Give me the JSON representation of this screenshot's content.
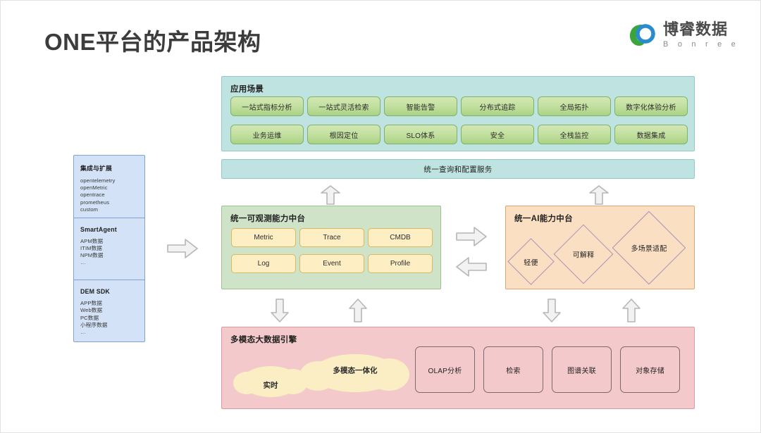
{
  "header": {
    "title": "ONE平台的产品架构",
    "logo": {
      "cn": "博睿数据",
      "en": "B o n r e e",
      "mark_green": "#3aa63a",
      "mark_blue": "#2b8ccc"
    }
  },
  "scenario": {
    "title": "应用场景",
    "panel_color": "#bfe3e0",
    "button_color": "#c3e0a0",
    "items": [
      "一站式指标分析",
      "一站式灵活检索",
      "智能告警",
      "分布式追踪",
      "全局拓扑",
      "数字化体验分析",
      "业务运维",
      "根因定位",
      "SLO体系",
      "安全",
      "全栈监控",
      "数据集成"
    ]
  },
  "query_bar": {
    "label": "统一查询和配置服务",
    "color": "#bfe3e0"
  },
  "sidebar": {
    "panel_color": "#d3e2f7",
    "sections": [
      {
        "title": "集成与扩展",
        "items": [
          "opentelemetry",
          "openMetric",
          "opentrace",
          "prometheus",
          "custom",
          "…"
        ]
      },
      {
        "title": "SmartAgent",
        "items": [
          "APM数据",
          "ITIM数据",
          "NPM数据",
          "…"
        ]
      },
      {
        "title": "DEM SDK",
        "items": [
          "APP数据",
          "Web数据",
          "PC数据",
          "小程序数据",
          "…"
        ]
      }
    ]
  },
  "observability": {
    "title": "统一可观测能力中台",
    "panel_color": "#cfe3c8",
    "capability_color": "#fdeec4",
    "items": [
      "Metric",
      "Trace",
      "CMDB",
      "Log",
      "Event",
      "Profile"
    ]
  },
  "ai_platform": {
    "title": "统一AI能力中台",
    "panel_color": "#fbdfc3",
    "diamond_border": "#a892b8",
    "items": [
      "轻便",
      "可解释",
      "多场景适配"
    ]
  },
  "data_engine": {
    "title": "多模态大数据引擎",
    "panel_color": "#f3c9cc",
    "cloud_color": "#fbeec4",
    "clouds": [
      "实时",
      "多模态一体化"
    ],
    "boxes": [
      "OLAP分析",
      "检索",
      "图谱关联",
      "对象存储"
    ]
  },
  "arrows": {
    "fill": "#f2f2f2",
    "stroke": "#b6b6b6",
    "names": [
      "sidebar-to-observability-right-arrow",
      "observability-to-query-up-arrow",
      "ai-to-query-up-arrow",
      "observability-to-ai-right-arrow",
      "ai-to-observability-left-arrow",
      "observability-to-engine-down-arrow",
      "engine-to-observability-up-arrow",
      "ai-to-engine-down-arrow",
      "engine-to-ai-up-arrow"
    ]
  }
}
